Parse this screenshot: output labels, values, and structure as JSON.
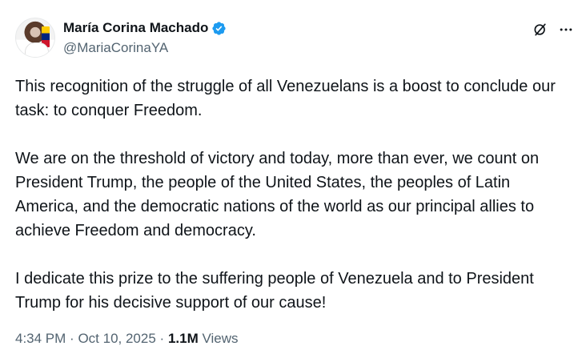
{
  "author": {
    "display_name": "María Corina Machado",
    "handle": "@MariaCorinaYA",
    "verified": true
  },
  "body": {
    "paragraphs": [
      "This recognition of the struggle of all Venezuelans is a boost to conclude our task: to conquer Freedom.",
      "We are on the threshold of victory and today, more than ever, we count on President Trump, the people of the United States, the peoples of Latin America, and the democratic nations of the world as our principal allies to achieve Freedom and democracy.",
      "I dedicate this prize to the suffering people of Venezuela and to President Trump for his decisive support of our cause!"
    ]
  },
  "meta": {
    "time": "4:34 PM",
    "separator": "·",
    "date": "Oct 10, 2025",
    "views_count": "1.1M",
    "views_label": "Views"
  },
  "icons": {
    "verified": "verified-badge-icon",
    "grok": "grok-icon",
    "more": "more-icon"
  },
  "colors": {
    "text": "#0f1419",
    "secondary": "#536471",
    "verified": "#1d9bf0"
  }
}
